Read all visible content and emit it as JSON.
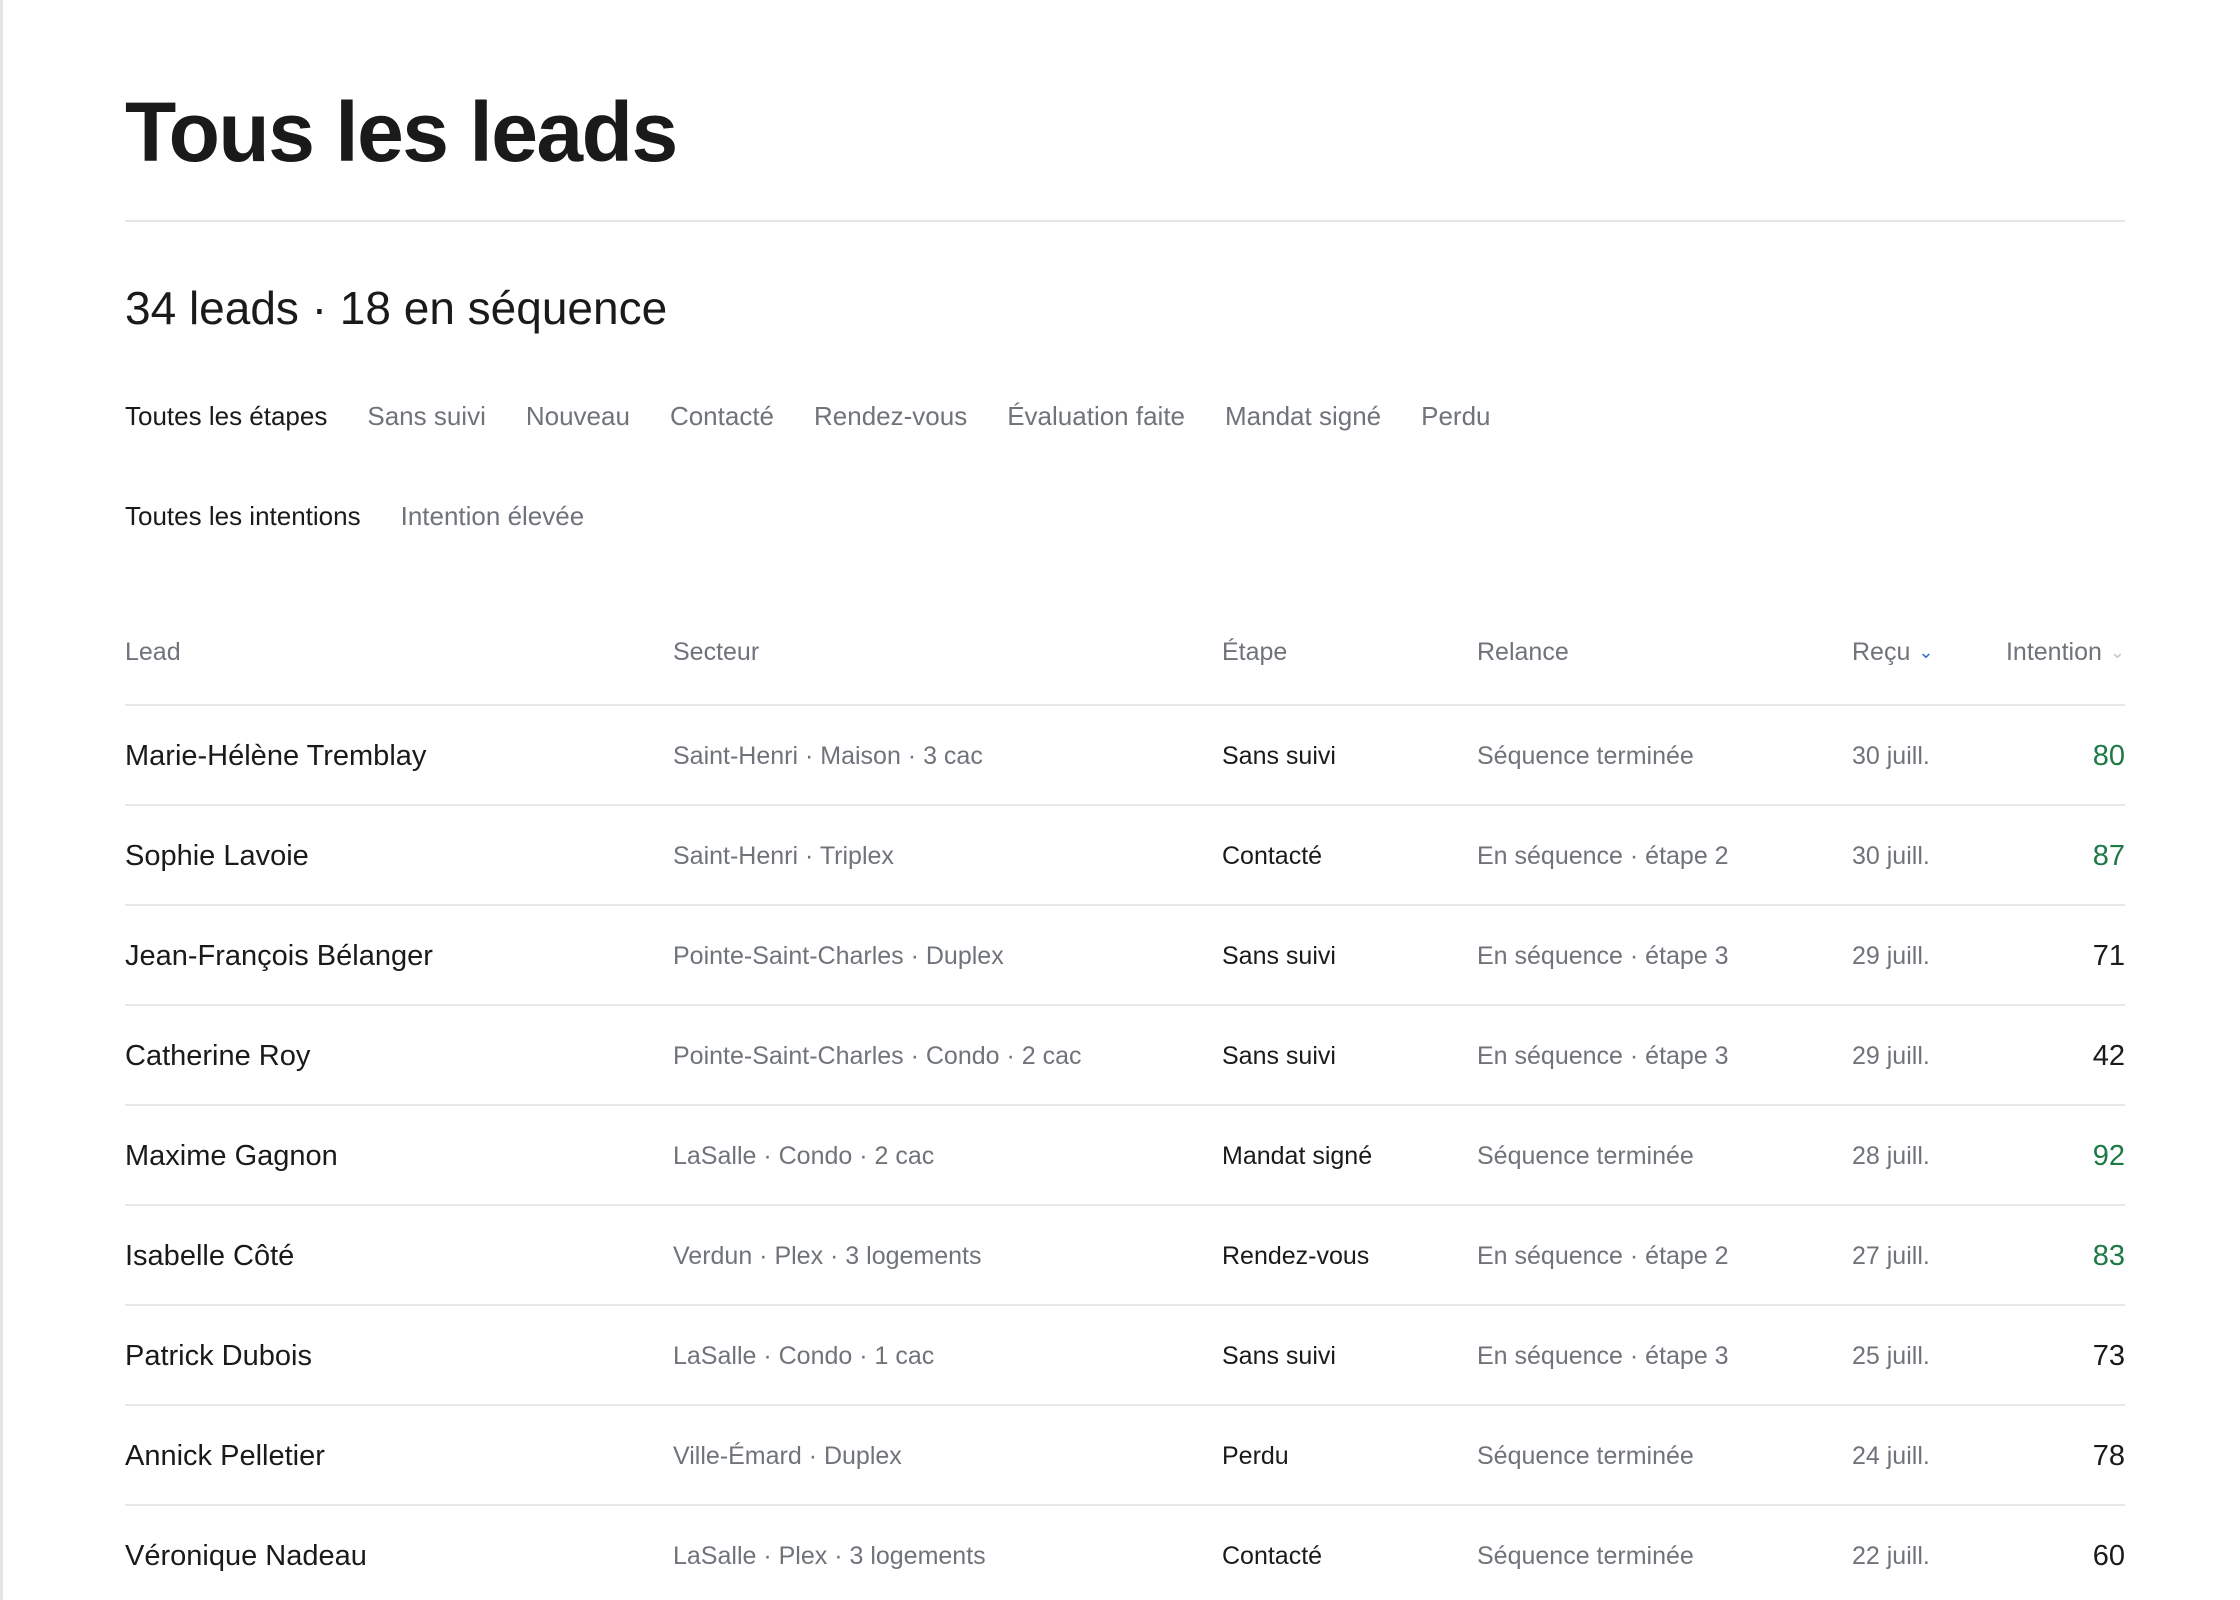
{
  "page": {
    "title": "Tous les leads",
    "summary": "34 leads · 18 en séquence"
  },
  "filters": {
    "stages": [
      "Toutes les étapes",
      "Sans suivi",
      "Nouveau",
      "Contacté",
      "Rendez-vous",
      "Évaluation faite",
      "Mandat signé",
      "Perdu"
    ],
    "active_stage": "Toutes les étapes",
    "intents": [
      "Toutes les intentions",
      "Intention élevée"
    ],
    "active_intent": "Toutes les intentions"
  },
  "table": {
    "columns": {
      "lead": "Lead",
      "sector": "Secteur",
      "stage": "Étape",
      "relance": "Relance",
      "received": "Reçu",
      "intention": "Intention"
    },
    "sort": {
      "column": "received",
      "direction": "desc",
      "icon": "chevron-down-icon"
    },
    "high_intent_color": "#1d7a45",
    "rows": [
      {
        "name": "Marie-Hélène Tremblay",
        "sector": "Saint-Henri · Maison · 3 cac",
        "stage": "Sans suivi",
        "relance": "Séquence terminée",
        "received": "30 juill.",
        "intention": "80",
        "high": true
      },
      {
        "name": "Sophie Lavoie",
        "sector": "Saint-Henri · Triplex",
        "stage": "Contacté",
        "relance": "En séquence · étape 2",
        "received": "30 juill.",
        "intention": "87",
        "high": true
      },
      {
        "name": "Jean-François Bélanger",
        "sector": "Pointe-Saint-Charles · Duplex",
        "stage": "Sans suivi",
        "relance": "En séquence · étape 3",
        "received": "29 juill.",
        "intention": "71",
        "high": false
      },
      {
        "name": "Catherine Roy",
        "sector": "Pointe-Saint-Charles · Condo · 2 cac",
        "stage": "Sans suivi",
        "relance": "En séquence · étape 3",
        "received": "29 juill.",
        "intention": "42",
        "high": false
      },
      {
        "name": "Maxime Gagnon",
        "sector": "LaSalle · Condo · 2 cac",
        "stage": "Mandat signé",
        "relance": "Séquence terminée",
        "received": "28 juill.",
        "intention": "92",
        "high": true
      },
      {
        "name": "Isabelle Côté",
        "sector": "Verdun · Plex · 3 logements",
        "stage": "Rendez-vous",
        "relance": "En séquence · étape 2",
        "received": "27 juill.",
        "intention": "83",
        "high": true
      },
      {
        "name": "Patrick Dubois",
        "sector": "LaSalle · Condo · 1 cac",
        "stage": "Sans suivi",
        "relance": "En séquence · étape 3",
        "received": "25 juill.",
        "intention": "73",
        "high": false
      },
      {
        "name": "Annick Pelletier",
        "sector": "Ville-Émard · Duplex",
        "stage": "Perdu",
        "relance": "Séquence terminée",
        "received": "24 juill.",
        "intention": "78",
        "high": false
      },
      {
        "name": "Véronique Nadeau",
        "sector": "LaSalle · Plex · 3 logements",
        "stage": "Contacté",
        "relance": "Séquence terminée",
        "received": "22 juill.",
        "intention": "60",
        "high": false
      }
    ]
  }
}
